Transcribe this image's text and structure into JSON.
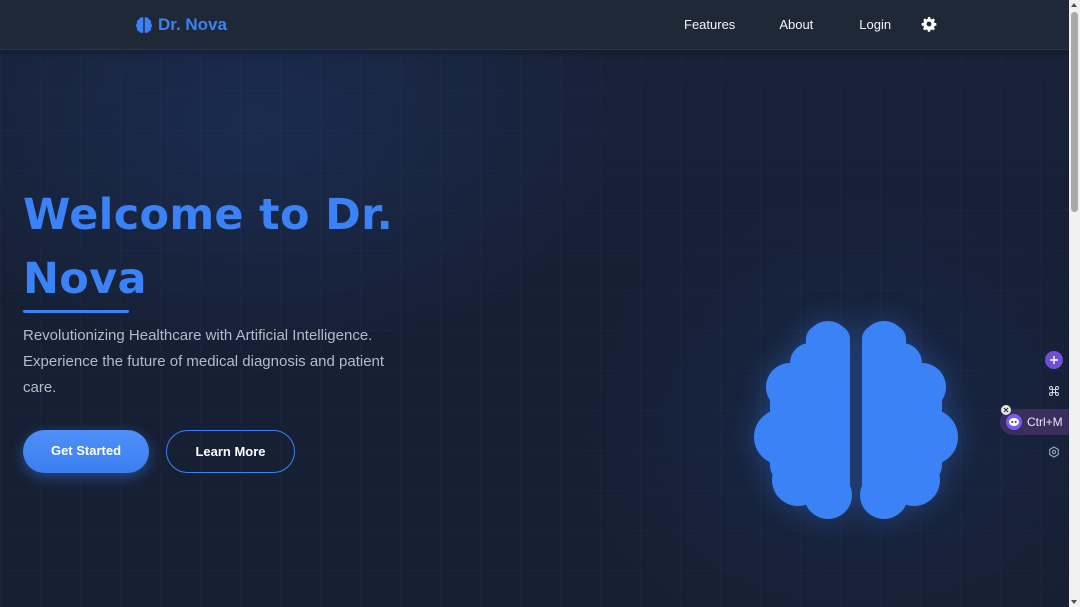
{
  "navbar": {
    "brand": "Dr. Nova",
    "brand_icon": "brain-icon",
    "links": [
      "Features",
      "About",
      "Login"
    ],
    "theme_toggle_icon": "gear-icon"
  },
  "hero": {
    "title": "Welcome to Dr. Nova",
    "subtitle": "Revolutionizing Healthcare with Artificial Intelligence. Experience the future of medical diagnosis and patient care.",
    "primary_button": "Get Started",
    "secondary_button": "Learn More",
    "illustration_icon": "brain-icon"
  },
  "side_widget": {
    "add_icon": "plus-icon",
    "command_icon": "command-icon",
    "extension_shortcut": "Ctrl+M",
    "extension_icon": "assistant-logo-icon",
    "close_icon": "close-icon",
    "settings_icon": "settings-icon"
  },
  "colors": {
    "accent": "#3b82f6",
    "navbar_bg": "#1f2836",
    "page_bg": "#172032",
    "text_muted": "#b4bcc8",
    "extension_purple": "#6d4fd8"
  }
}
